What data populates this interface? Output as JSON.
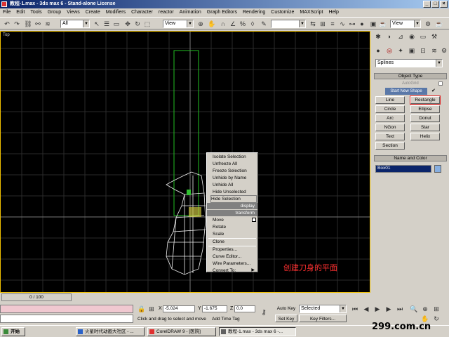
{
  "window": {
    "title": "教程-1.max - 3ds max 6 - Stand-alone License"
  },
  "menu": [
    "File",
    "Edit",
    "Tools",
    "Group",
    "Views",
    "Create",
    "Modifiers",
    "Character",
    "reactor",
    "Animation",
    "Graph Editors",
    "Rendering",
    "Customize",
    "MAXScript",
    "Help"
  ],
  "toolbar": {
    "filter": "All",
    "refcoord": "View",
    "named_sel": "View"
  },
  "viewport": {
    "label": "Top"
  },
  "command_panel": {
    "dropdown": "Splines",
    "object_type_title": "Object Type",
    "autogrid": "AutoGrid",
    "start_new_shape": "Start New Shape",
    "buttons": [
      "Line",
      "Rectangle",
      "Circle",
      "Ellipse",
      "Arc",
      "Donut",
      "NGon",
      "Star",
      "Text",
      "Helix",
      "Section"
    ],
    "name_color_title": "Name and Color",
    "object_name": "Box01",
    "highlight_color": "#e02020"
  },
  "context_menu": {
    "items_top": [
      "Isolate Selection",
      "Unfreeze All",
      "Freeze Selection",
      "Unhide by Name",
      "Unhide All",
      "Hide Unselected",
      "Hide Selection"
    ],
    "hdr_display": "display",
    "hdr_transform": "transform",
    "items_bottom": [
      "Move",
      "Rotate",
      "Scale",
      "Clone",
      "Properties...",
      "Curve Editor...",
      "Wire Parameters...",
      "Convert To:"
    ]
  },
  "annotation": "创建刀身的平面",
  "status": {
    "frame": "0 / 100",
    "prompt": "Click and drag to select and move",
    "add_time_tag": "Add Time Tag",
    "x_label": "X",
    "x": "-5.024",
    "y_label": "Y",
    "y": "-1.675",
    "z_label": "Z",
    "z": "0.0",
    "auto_key": "Auto Key",
    "set_key": "Set Key",
    "selected": "Selected",
    "key_filters": "Key Filters..."
  },
  "taskbar": {
    "start": "开始",
    "tasks": [
      "火星时代动画大社区 - ...",
      "CorelDRAW 9 - [医院]",
      "教程-1.max - 3ds max 6 -..."
    ]
  },
  "watermark": "299.com.cn"
}
